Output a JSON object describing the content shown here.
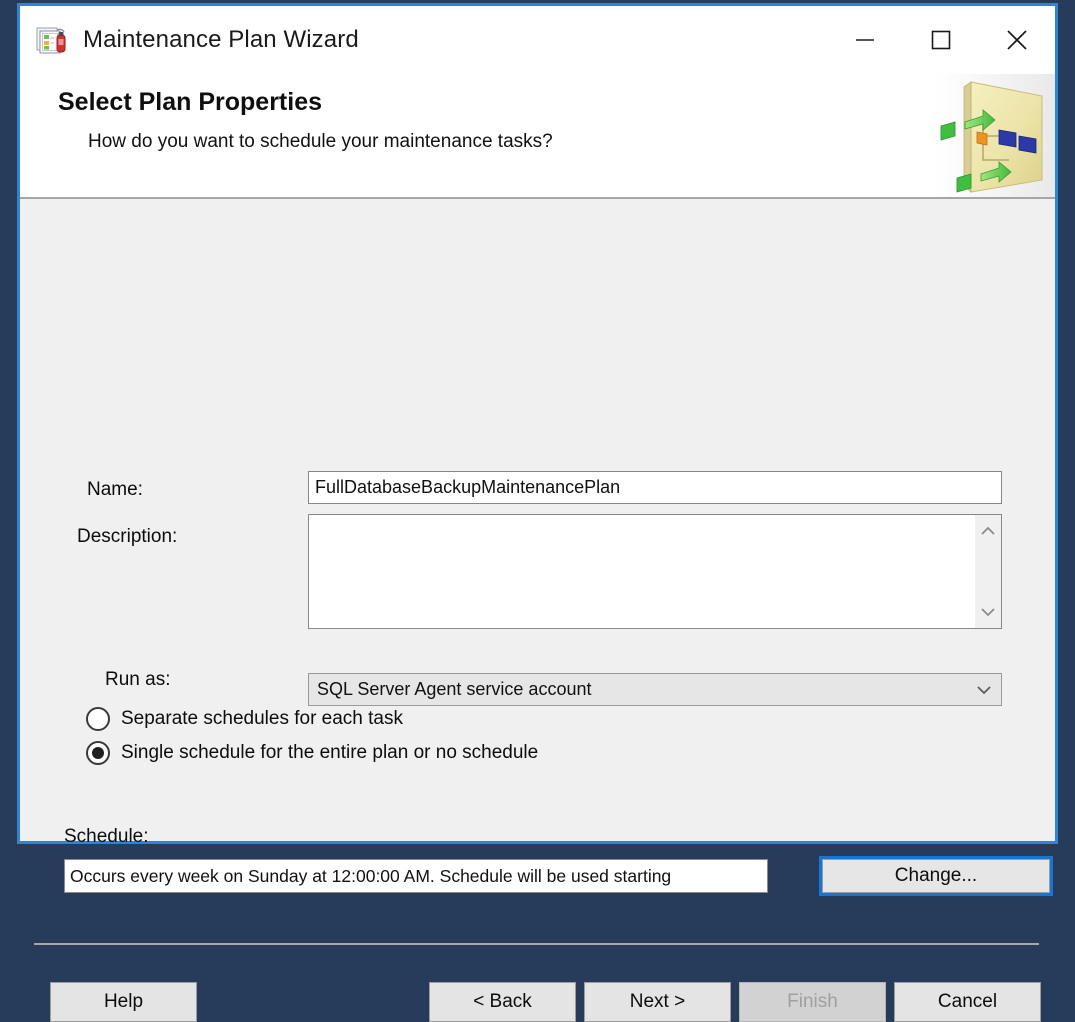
{
  "window": {
    "title": "Maintenance Plan Wizard",
    "title_icon": "maintenance-plan-icon",
    "accent_border": "#2b85d8",
    "desktop_background": "#273c5a",
    "controls": {
      "minimize": "minimize-icon",
      "maximize": "maximize-icon",
      "close": "close-icon"
    }
  },
  "header": {
    "title": "Select Plan Properties",
    "subtitle": "How do you want to schedule your maintenance tasks?",
    "art": "workflow-diagram-banner"
  },
  "form": {
    "name": {
      "label": "Name:",
      "value": "FullDatabaseBackupMaintenancePlan",
      "placeholder": ""
    },
    "description": {
      "label": "Description:",
      "value": "",
      "placeholder": "",
      "scroll_up_icon": "chevron-up-icon",
      "scroll_down_icon": "chevron-down-icon"
    },
    "run_as": {
      "label": "Run as:",
      "value": "SQL Server Agent service account",
      "options": [
        "SQL Server Agent service account"
      ],
      "arrow_icon": "chevron-down-icon"
    },
    "schedule_mode": {
      "options": [
        {
          "label": "Separate schedules for each task",
          "selected": false
        },
        {
          "label": "Single schedule for the entire plan or no schedule",
          "selected": true
        }
      ]
    },
    "schedule": {
      "label": "Schedule:",
      "value": "Occurs every week on Sunday at 12:00:00 AM. Schedule will be used starting",
      "change_button": "Change...",
      "change_button_focused": true,
      "focus_color": "#1477d4"
    }
  },
  "footer": {
    "buttons": [
      {
        "label": "Help",
        "enabled": true
      },
      {
        "label": "< Back",
        "enabled": true
      },
      {
        "label": "Next >",
        "enabled": true
      },
      {
        "label": "Finish",
        "enabled": false
      },
      {
        "label": "Cancel",
        "enabled": true
      }
    ]
  }
}
